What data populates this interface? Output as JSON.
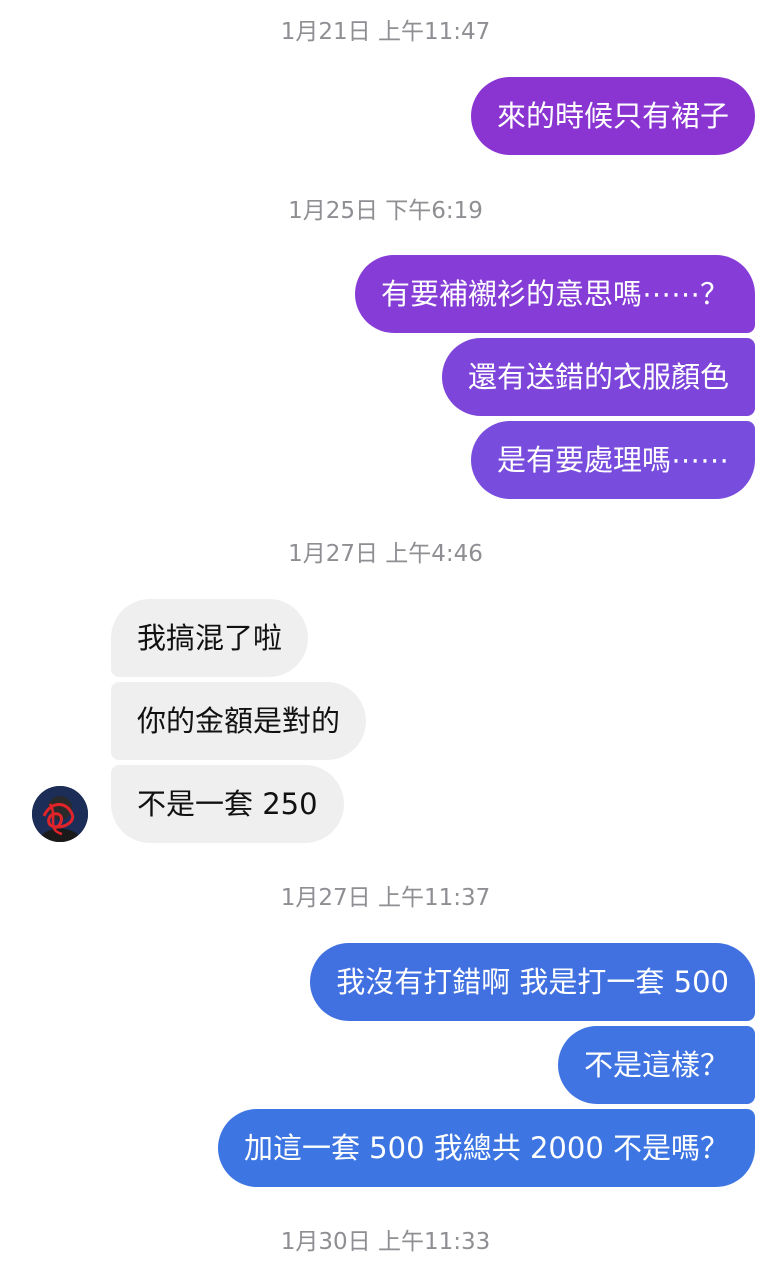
{
  "timestamps": [
    "1月21日 上午11:47",
    "1月25日 下午6:19",
    "1月27日 上午4:46",
    "1月27日 上午11:37",
    "1月30日 上午11:33"
  ],
  "messages": [
    "來的時候只有裙子",
    "有要補襯衫的意思嗎⋯⋯？",
    "還有送錯的衣服顏色",
    "是有要處理嗎⋯⋯",
    "我搞混了啦",
    "你的金額是對的",
    "不是一套 250",
    "我沒有打錯啊 我是打一套 500",
    "不是這樣？",
    "加這一套 500 我總共 2000 不是嗎？"
  ],
  "colors": {
    "outgoing_purple": "#8936d3",
    "outgoing_violet": "#7a48dc",
    "outgoing_blue": "#3f72e2",
    "incoming_gray": "#efeff0",
    "timestamp_gray": "#8e8e93"
  },
  "avatar": {
    "icon": "profile-avatar"
  }
}
